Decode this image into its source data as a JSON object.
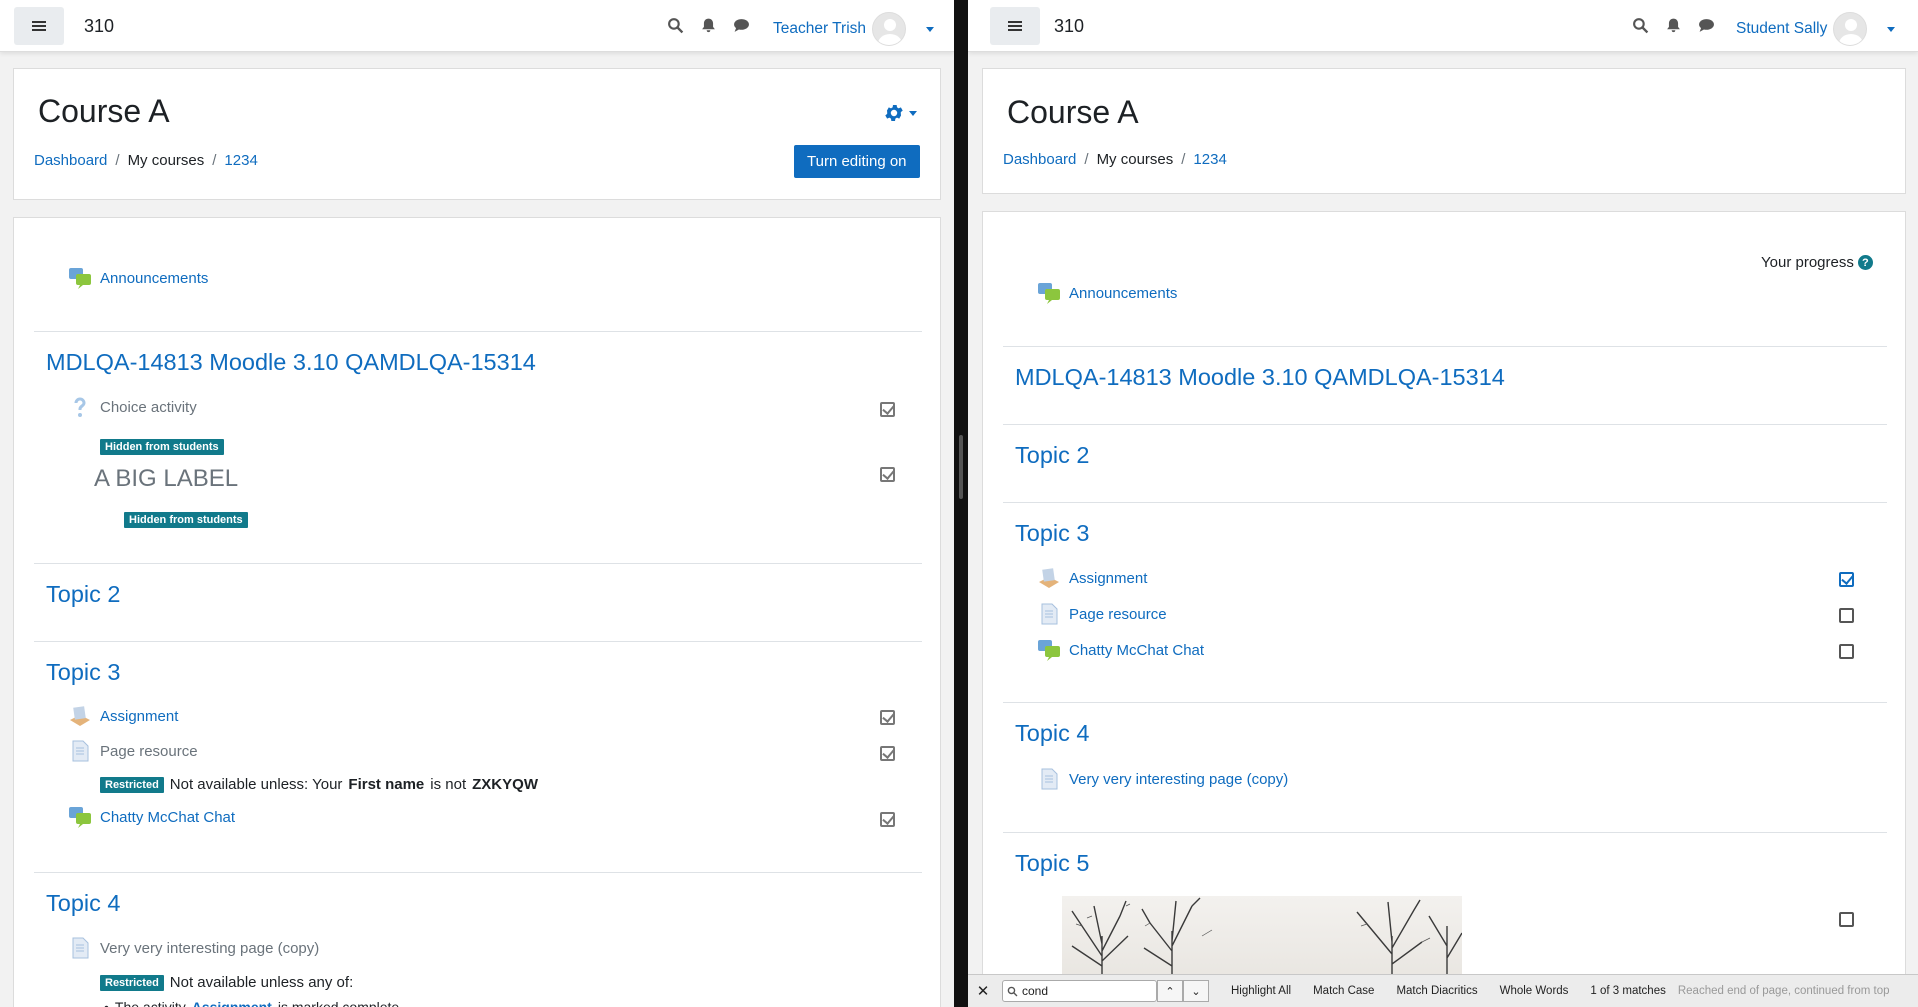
{
  "left": {
    "site_name": "310",
    "user_name": "Teacher Trish",
    "course_title": "Course A",
    "breadcrumb": [
      "Dashboard",
      "My courses",
      "1234"
    ],
    "edit_button": "Turn editing on",
    "announcements": "Announcements",
    "section1_title": "MDLQA-14813 Moodle 3.10 QAMDLQA-15314",
    "choice": "Choice activity",
    "hidden_badge": "Hidden from students",
    "big_label": "A BIG LABEL",
    "topic2": "Topic 2",
    "topic3": "Topic 3",
    "assignment": "Assignment",
    "page_resource": "Page resource",
    "restricted_badge": "Restricted",
    "restrict_text_pre": "Not available unless: Your",
    "restrict_bold1": "First name",
    "restrict_mid": "is not",
    "restrict_bold2": "ZXKYQW",
    "chat": "Chatty McChat Chat",
    "topic4": "Topic 4",
    "interesting_page": "Very very interesting page (copy)",
    "restrict2_text": "Not available unless any of:",
    "restrict2_sub_pre": "The activity",
    "restrict2_sub_link": "Assignment",
    "restrict2_sub_post": "is marked complete"
  },
  "right": {
    "site_name": "310",
    "user_name": "Student Sally",
    "course_title": "Course A",
    "breadcrumb": [
      "Dashboard",
      "My courses",
      "1234"
    ],
    "progress": "Your progress",
    "announcements": "Announcements",
    "section1_title": "MDLQA-14813 Moodle 3.10 QAMDLQA-15314",
    "topic2": "Topic 2",
    "topic3": "Topic 3",
    "assignment": "Assignment",
    "page_resource": "Page resource",
    "chat": "Chatty McChat Chat",
    "topic4": "Topic 4",
    "interesting_page": "Very very interesting page (copy)",
    "topic5": "Topic 5"
  },
  "findbar": {
    "close": "✕",
    "query": "cond",
    "highlight_all": "Highlight All",
    "match_case": "Match Case",
    "match_diacritics": "Match Diacritics",
    "whole_words": "Whole Words",
    "matches": "1 of 3 matches",
    "status": "Reached end of page, continued from top"
  },
  "colors": {
    "link": "#0f6cbf",
    "badge": "#117a8b"
  }
}
